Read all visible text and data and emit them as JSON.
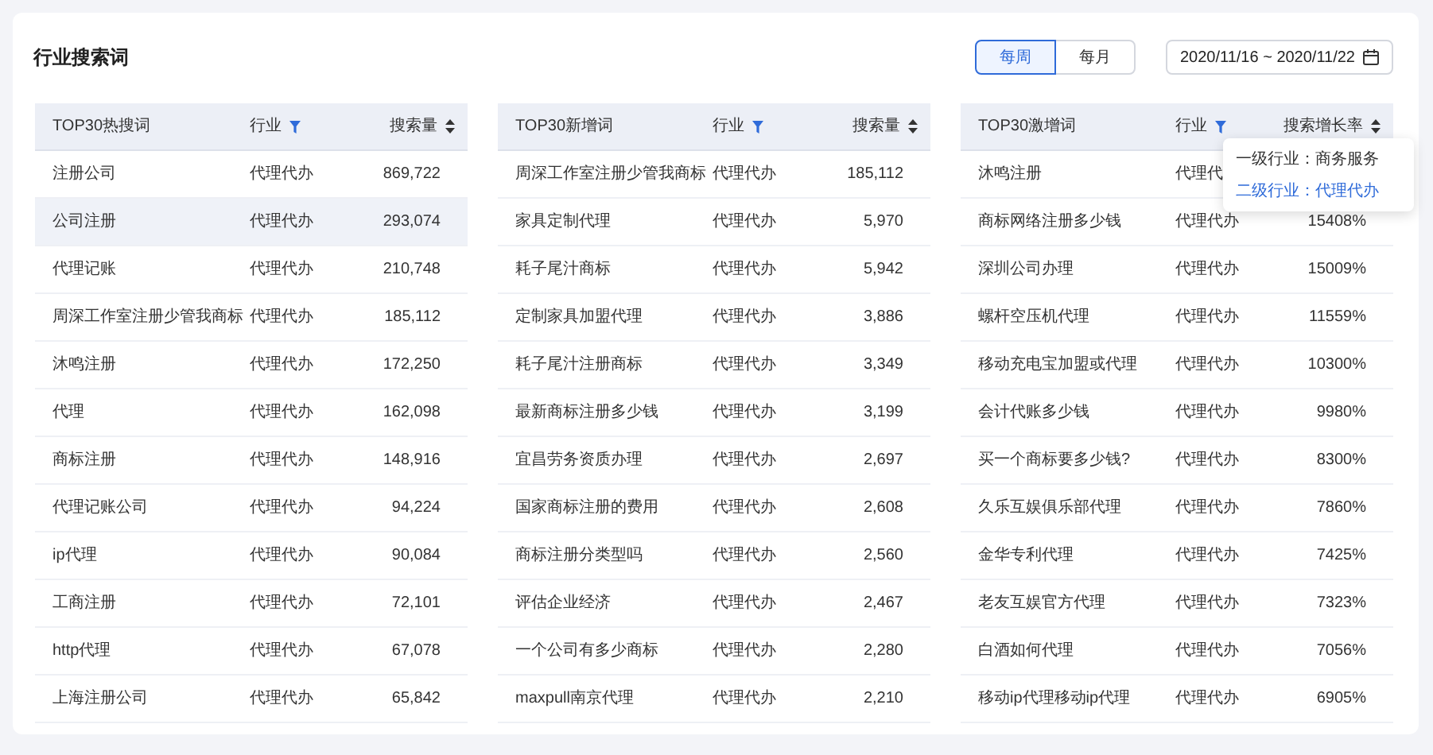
{
  "title": "行业搜索词",
  "period_toggle": [
    {
      "label": "每周",
      "selected": true
    },
    {
      "label": "每月",
      "selected": false
    }
  ],
  "date_range": "2020/11/16 ~ 2020/11/22",
  "tables": [
    {
      "columns": [
        "TOP30热搜词",
        "行业",
        "搜索量"
      ],
      "rows": [
        {
          "keyword": "注册公司",
          "industry": "代理代办",
          "value": "869,722",
          "hovered": false
        },
        {
          "keyword": "公司注册",
          "industry": "代理代办",
          "value": "293,074",
          "hovered": true
        },
        {
          "keyword": "代理记账",
          "industry": "代理代办",
          "value": "210,748",
          "hovered": false
        },
        {
          "keyword": "周深工作室注册少管我商标",
          "industry": "代理代办",
          "value": "185,112",
          "hovered": false
        },
        {
          "keyword": "沐鸣注册",
          "industry": "代理代办",
          "value": "172,250",
          "hovered": false
        },
        {
          "keyword": "代理",
          "industry": "代理代办",
          "value": "162,098",
          "hovered": false
        },
        {
          "keyword": "商标注册",
          "industry": "代理代办",
          "value": "148,916",
          "hovered": false
        },
        {
          "keyword": "代理记账公司",
          "industry": "代理代办",
          "value": "94,224",
          "hovered": false
        },
        {
          "keyword": "ip代理",
          "industry": "代理代办",
          "value": "90,084",
          "hovered": false
        },
        {
          "keyword": "工商注册",
          "industry": "代理代办",
          "value": "72,101",
          "hovered": false
        },
        {
          "keyword": "http代理",
          "industry": "代理代办",
          "value": "67,078",
          "hovered": false
        },
        {
          "keyword": "上海注册公司",
          "industry": "代理代办",
          "value": "65,842",
          "hovered": false
        }
      ]
    },
    {
      "columns": [
        "TOP30新增词",
        "行业",
        "搜索量"
      ],
      "rows": [
        {
          "keyword": "周深工作室注册少管我商标",
          "industry": "代理代办",
          "value": "185,112",
          "hovered": false
        },
        {
          "keyword": "家具定制代理",
          "industry": "代理代办",
          "value": "5,970",
          "hovered": false
        },
        {
          "keyword": "耗子尾汁商标",
          "industry": "代理代办",
          "value": "5,942",
          "hovered": false
        },
        {
          "keyword": "定制家具加盟代理",
          "industry": "代理代办",
          "value": "3,886",
          "hovered": false
        },
        {
          "keyword": "耗子尾汁注册商标",
          "industry": "代理代办",
          "value": "3,349",
          "hovered": false
        },
        {
          "keyword": "最新商标注册多少钱",
          "industry": "代理代办",
          "value": "3,199",
          "hovered": false
        },
        {
          "keyword": "宜昌劳务资质办理",
          "industry": "代理代办",
          "value": "2,697",
          "hovered": false
        },
        {
          "keyword": "国家商标注册的费用",
          "industry": "代理代办",
          "value": "2,608",
          "hovered": false
        },
        {
          "keyword": "商标注册分类型吗",
          "industry": "代理代办",
          "value": "2,560",
          "hovered": false
        },
        {
          "keyword": "评估企业经济",
          "industry": "代理代办",
          "value": "2,467",
          "hovered": false
        },
        {
          "keyword": "一个公司有多少商标",
          "industry": "代理代办",
          "value": "2,280",
          "hovered": false
        },
        {
          "keyword": "maxpull南京代理",
          "industry": "代理代办",
          "value": "2,210",
          "hovered": false
        }
      ]
    },
    {
      "columns": [
        "TOP30激增词",
        "行业",
        "搜索增长率"
      ],
      "rows": [
        {
          "keyword": "沐鸣注册",
          "industry": "代理代",
          "hovered": false
        },
        {
          "keyword": "商标网络注册多少钱",
          "industry": "代理代办",
          "value": "15408%",
          "hovered": false
        },
        {
          "keyword": "深圳公司办理",
          "industry": "代理代办",
          "value": "15009%",
          "hovered": false
        },
        {
          "keyword": "螺杆空压机代理",
          "industry": "代理代办",
          "value": "11559%",
          "hovered": false
        },
        {
          "keyword": "移动充电宝加盟或代理",
          "industry": "代理代办",
          "value": "10300%",
          "hovered": false
        },
        {
          "keyword": "会计代账多少钱",
          "industry": "代理代办",
          "value": "9980%",
          "hovered": false
        },
        {
          "keyword": "买一个商标要多少钱?",
          "industry": "代理代办",
          "value": "8300%",
          "hovered": false
        },
        {
          "keyword": "久乐互娱俱乐部代理",
          "industry": "代理代办",
          "value": "7860%",
          "hovered": false
        },
        {
          "keyword": "金华专利代理",
          "industry": "代理代办",
          "value": "7425%",
          "hovered": false
        },
        {
          "keyword": "老友互娱官方代理",
          "industry": "代理代办",
          "value": "7323%",
          "hovered": false
        },
        {
          "keyword": "白酒如何代理",
          "industry": "代理代办",
          "value": "7056%",
          "hovered": false
        },
        {
          "keyword": "移动ip代理移动ip代理",
          "industry": "代理代办",
          "value": "6905%",
          "hovered": false
        }
      ],
      "filter_menu": {
        "options": [
          {
            "label": "一级行业：商务服务",
            "selected": false
          },
          {
            "label": "二级行业：代理代办",
            "selected": true
          }
        ]
      }
    }
  ]
}
